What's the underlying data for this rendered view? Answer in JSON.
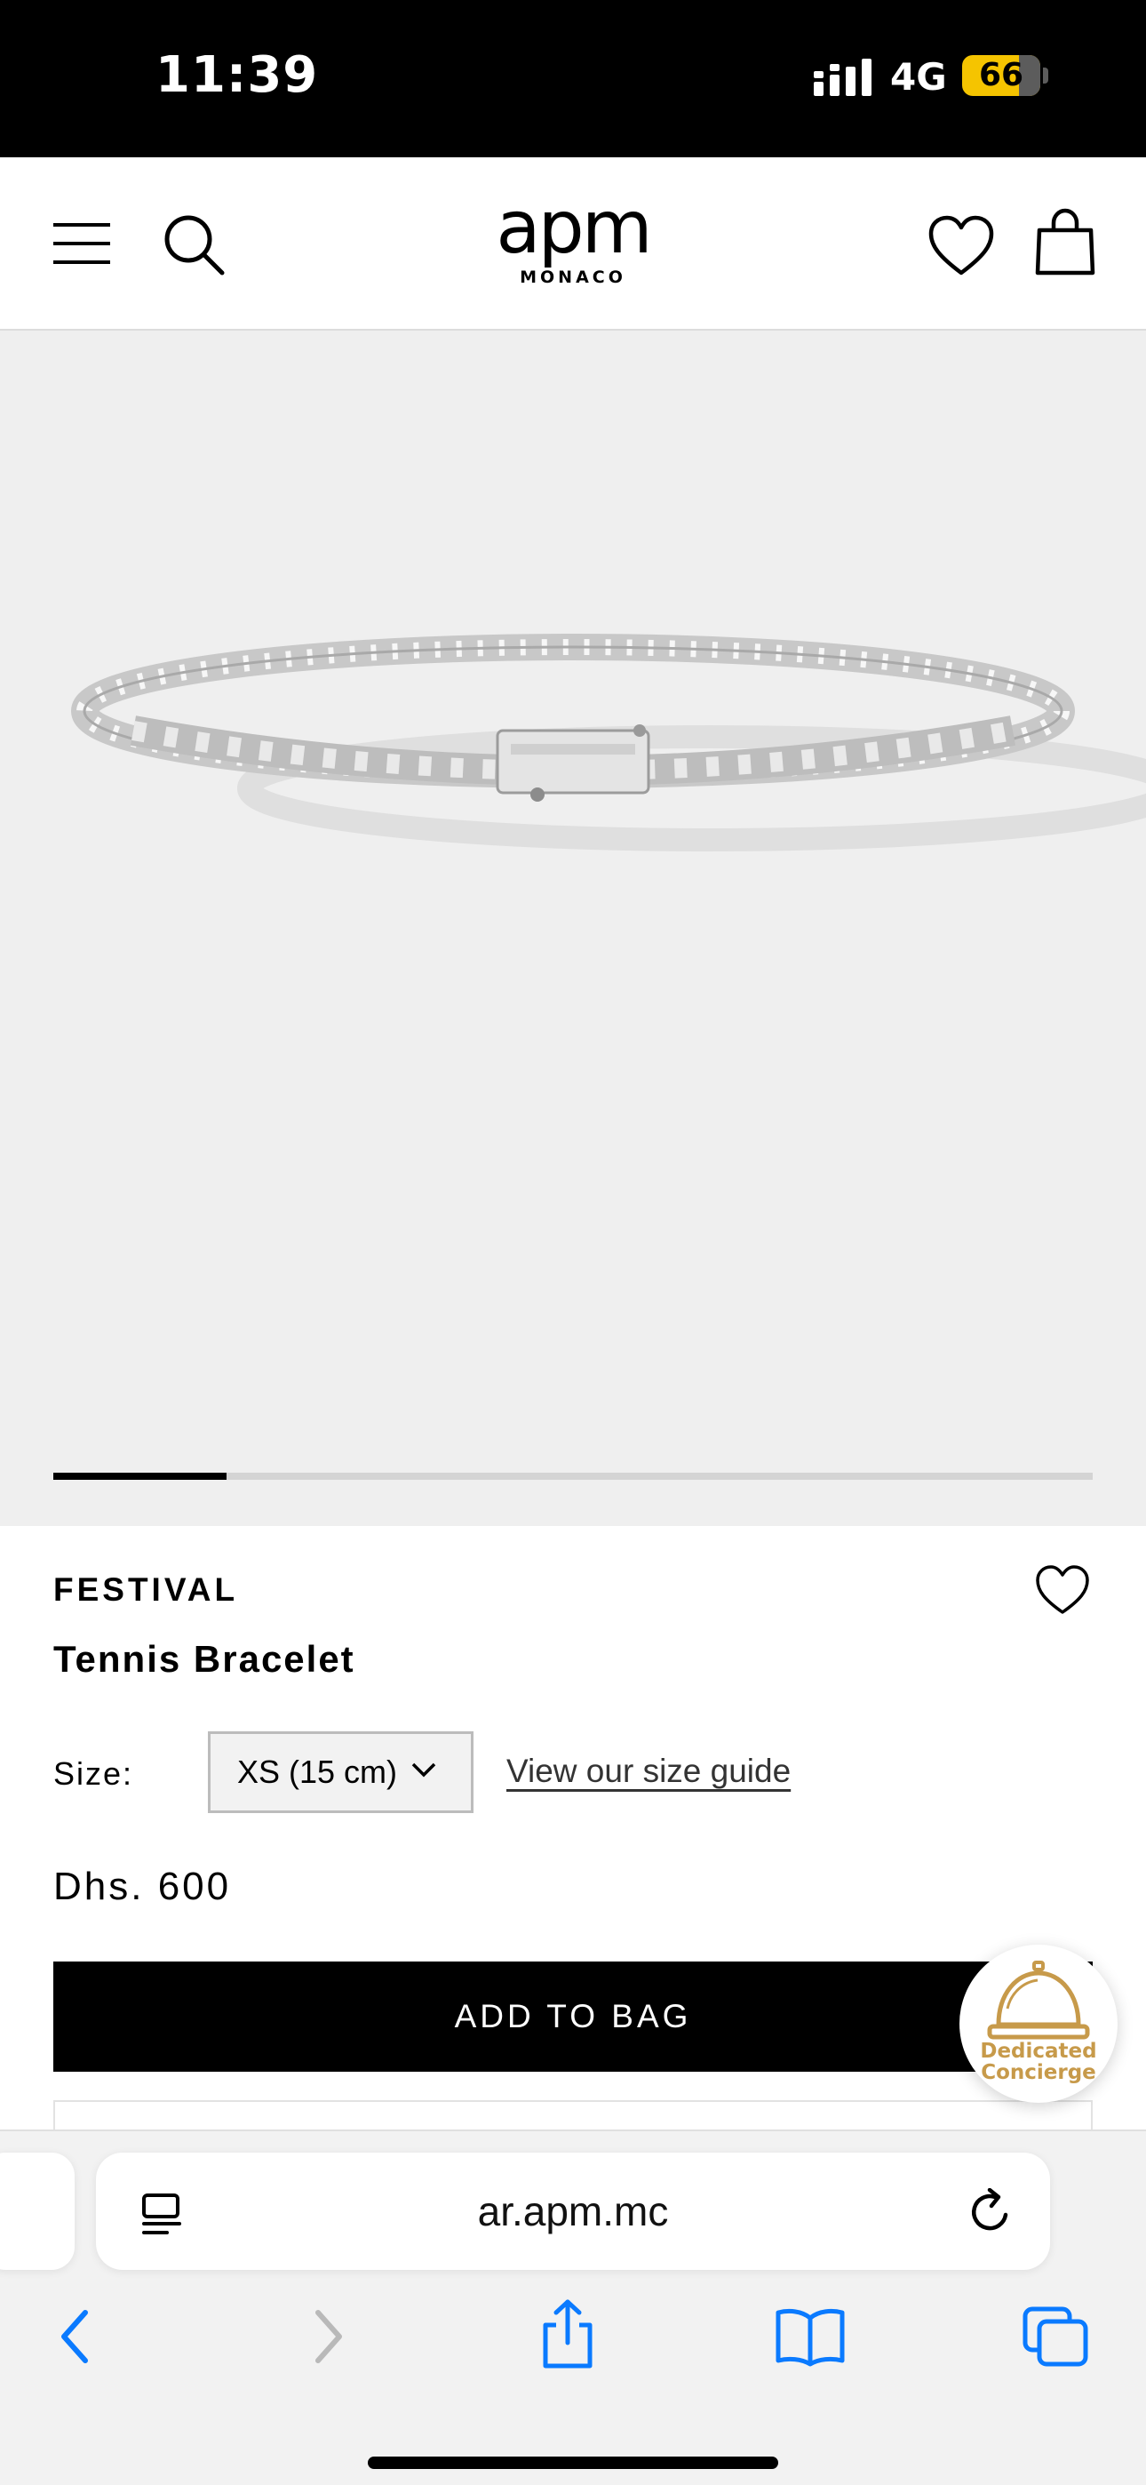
{
  "status_bar": {
    "time": "11:39",
    "network": "4G",
    "battery": "66"
  },
  "header": {
    "logo": "apm",
    "logo_sub": "MONACO"
  },
  "gallery": {
    "progress_fraction": 0.167
  },
  "product": {
    "brand": "FESTIVAL",
    "name": "Tennis Bracelet",
    "size_label": "Size:",
    "size_selected": "XS (15 cm)",
    "size_guide_link": "View our size guide",
    "price": "Dhs. 600",
    "add_to_bag": "ADD TO BAG"
  },
  "concierge": {
    "line1": "Dedicated",
    "line2": "Concierge",
    "color": "#c79a4a"
  },
  "browser": {
    "url": "ar.apm.mc",
    "accent": "#0a7aff"
  }
}
